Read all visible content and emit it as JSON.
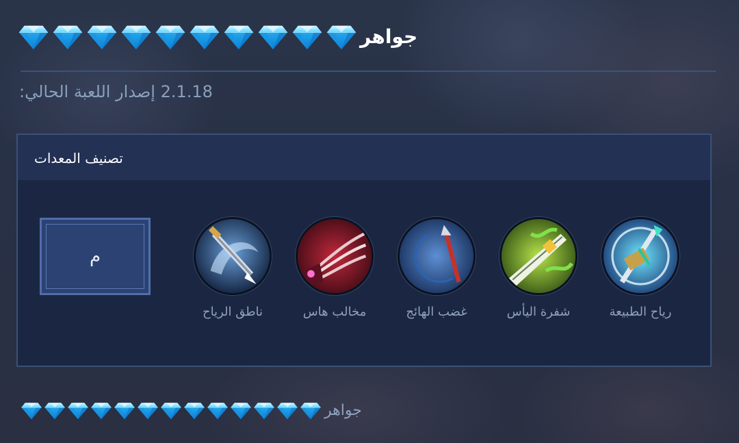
{
  "header": {
    "title": "جواهر",
    "gem_icon": "diamond-icon",
    "gem_count": 10
  },
  "version_text": "2.1.18 إصدار اللعبة الحالي:",
  "panel": {
    "title": "تصنيف المعدات",
    "selector_label": "م",
    "items": [
      {
        "label": "رياح الطبيعة",
        "icon": "nature-wind-icon"
      },
      {
        "label": "شفرة اليأس",
        "icon": "blade-of-despair-icon"
      },
      {
        "label": "غضب الهائج",
        "icon": "berserkers-fury-icon"
      },
      {
        "label": "مخالب هاس",
        "icon": "haas-claws-icon"
      },
      {
        "label": "ناطق الرياح",
        "icon": "windtalker-icon"
      }
    ]
  },
  "footer": {
    "title": "جواهر",
    "gem_icon": "diamond-icon",
    "gem_count": 13
  },
  "colors": {
    "accent_gem": "#3fc8ff",
    "panel_border": "#3b5177",
    "text_muted": "#8fa2bd"
  }
}
